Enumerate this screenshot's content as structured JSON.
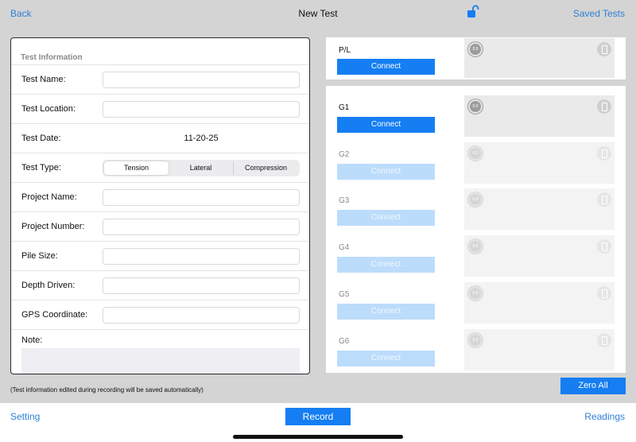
{
  "nav": {
    "back": "Back",
    "title": "New Test",
    "saved": "Saved Tests",
    "accent": "#2f7fd6"
  },
  "info": {
    "section_title": "Test Information",
    "test_name": {
      "label": "Test Name:",
      "value": ""
    },
    "test_location": {
      "label": "Test Location:",
      "value": ""
    },
    "test_date": {
      "label": "Test Date:",
      "value": "11-20-25"
    },
    "test_type": {
      "label": "Test Type:",
      "options": [
        "Tension",
        "Lateral",
        "Compression"
      ],
      "selected": "Tension"
    },
    "project_name": {
      "label": "Project Name:",
      "value": ""
    },
    "project_number": {
      "label": "Project Number:",
      "value": ""
    },
    "pile_size": {
      "label": "Pile Size:",
      "value": ""
    },
    "depth_driven": {
      "label": "Depth Driven:",
      "value": ""
    },
    "gps": {
      "label": "GPS Coordinate:",
      "value": ""
    },
    "note": {
      "label": "Note:",
      "value": ""
    }
  },
  "gauges": {
    "pl": {
      "label": "P/L",
      "button": "Connect",
      "enabled": true,
      "dial": "0.0"
    },
    "list": [
      {
        "label": "G1",
        "button": "Connect",
        "enabled": true,
        "dial": "0.0"
      },
      {
        "label": "G2",
        "button": "Connect",
        "enabled": false,
        "dial": "0.0"
      },
      {
        "label": "G3",
        "button": "Connect",
        "enabled": false,
        "dial": "0.0"
      },
      {
        "label": "G4",
        "button": "Connect",
        "enabled": false,
        "dial": "0.0"
      },
      {
        "label": "G5",
        "button": "Connect",
        "enabled": false,
        "dial": "0.0"
      },
      {
        "label": "G6",
        "button": "Connect",
        "enabled": false,
        "dial": "0.0"
      }
    ]
  },
  "footnote": "(Test information edited during recording will be saved automatically)",
  "zero_all": "Zero All",
  "toolbar": {
    "setting": "Setting",
    "record": "Record",
    "readings": "Readings"
  },
  "colors": {
    "primary": "#157ef3",
    "disabled": "#bcdcfb",
    "background": "#d4d4d4"
  }
}
